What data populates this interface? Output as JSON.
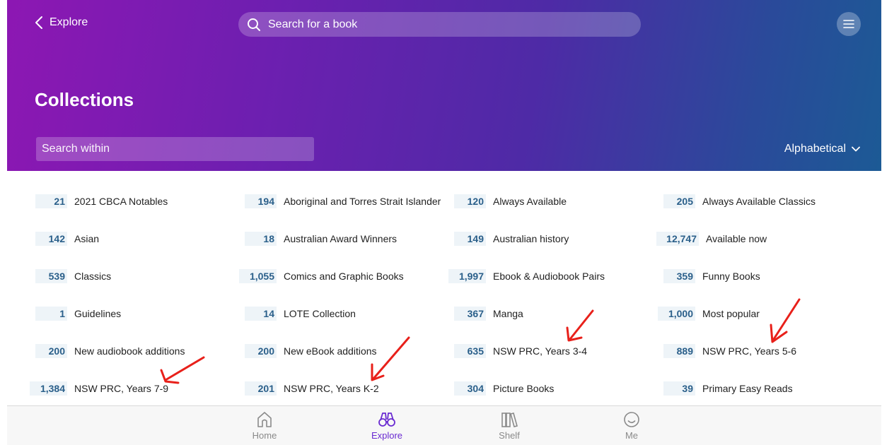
{
  "header": {
    "back_label": "Explore",
    "search_placeholder": "Search for a book",
    "title": "Collections",
    "search_within_placeholder": "Search within",
    "sort_label": "Alphabetical"
  },
  "collections": [
    {
      "count": "21",
      "label": "2021 CBCA Notables"
    },
    {
      "count": "194",
      "label": "Aboriginal and Torres Strait Islander"
    },
    {
      "count": "120",
      "label": "Always Available"
    },
    {
      "count": "205",
      "label": "Always Available Classics"
    },
    {
      "count": "142",
      "label": "Asian"
    },
    {
      "count": "18",
      "label": "Australian Award Winners"
    },
    {
      "count": "149",
      "label": "Australian history"
    },
    {
      "count": "12,747",
      "label": "Available now"
    },
    {
      "count": "539",
      "label": "Classics"
    },
    {
      "count": "1,055",
      "label": "Comics and Graphic Books"
    },
    {
      "count": "1,997",
      "label": "Ebook & Audiobook Pairs"
    },
    {
      "count": "359",
      "label": "Funny Books"
    },
    {
      "count": "1",
      "label": "Guidelines"
    },
    {
      "count": "14",
      "label": "LOTE Collection"
    },
    {
      "count": "367",
      "label": "Manga"
    },
    {
      "count": "1,000",
      "label": "Most popular"
    },
    {
      "count": "200",
      "label": "New audiobook additions"
    },
    {
      "count": "200",
      "label": "New eBook additions"
    },
    {
      "count": "635",
      "label": "NSW PRC, Years 3-4"
    },
    {
      "count": "889",
      "label": "NSW PRC, Years 5-6"
    },
    {
      "count": "1,384",
      "label": "NSW PRC, Years 7-9"
    },
    {
      "count": "201",
      "label": "NSW PRC, Years K-2"
    },
    {
      "count": "304",
      "label": "Picture Books"
    },
    {
      "count": "39",
      "label": "Primary Easy Reads"
    }
  ],
  "tabs": [
    {
      "label": "Home",
      "icon": "home-icon"
    },
    {
      "label": "Explore",
      "icon": "binoculars-icon"
    },
    {
      "label": "Shelf",
      "icon": "books-icon"
    },
    {
      "label": "Me",
      "icon": "smiley-icon"
    }
  ],
  "colors": {
    "accent": "#6a2bd1",
    "count_text": "#2a5f8a",
    "annotation": "#e8201a"
  }
}
